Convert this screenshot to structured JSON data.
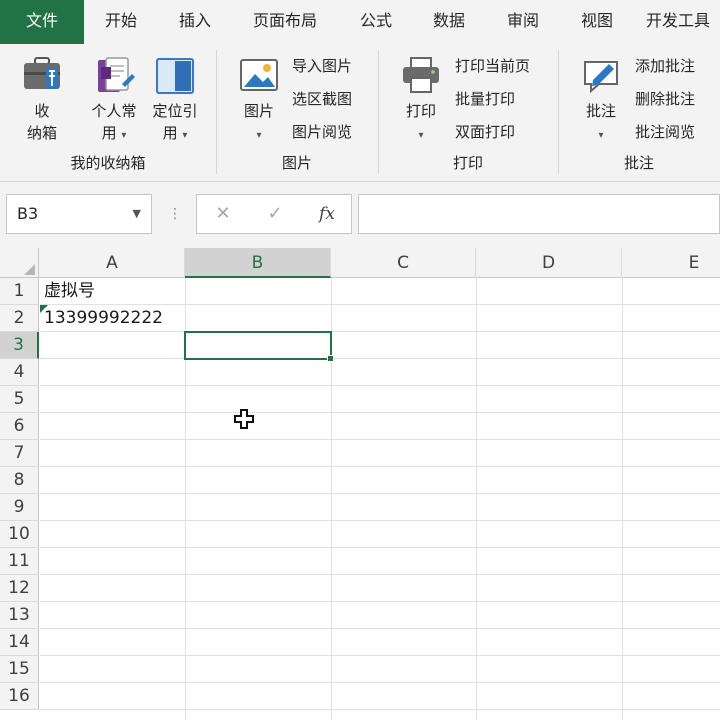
{
  "ribbon": {
    "tabs": [
      "文件",
      "开始",
      "插入",
      "页面布局",
      "公式",
      "数据",
      "审阅",
      "视图",
      "开发工具"
    ],
    "groups": {
      "storage": {
        "label": "我的收纳箱",
        "collect_line1": "收",
        "collect_line2": "纳箱",
        "personal_line1": "个人常",
        "personal_line2": "用",
        "locate_line1": "定位引",
        "locate_line2": "用"
      },
      "pictures": {
        "label": "图片",
        "picture_btn": "图片",
        "import": "导入图片",
        "capture": "选区截图",
        "browse": "图片阅览"
      },
      "print": {
        "label": "打印",
        "print_btn": "打印",
        "current": "打印当前页",
        "batch": "批量打印",
        "duplex": "双面打印"
      },
      "comments": {
        "label": "批注",
        "comment_btn": "批注",
        "add": "添加批注",
        "delete": "删除批注",
        "browse": "批注阅览"
      }
    }
  },
  "formula_bar": {
    "name_box": "B3",
    "dots": "⋮",
    "cancel": "✕",
    "confirm": "✓",
    "fx": "fx",
    "content": ""
  },
  "sheet": {
    "columns": [
      "A",
      "B",
      "C",
      "D",
      "E"
    ],
    "rows": [
      "1",
      "2",
      "3",
      "4",
      "5",
      "6",
      "7",
      "8",
      "9",
      "10",
      "11",
      "12",
      "13",
      "14",
      "15",
      "16"
    ],
    "active_cell": "B3",
    "cells": {
      "A1": "虚拟号",
      "A2": "13399992222"
    }
  },
  "colors": {
    "accent": "#217346",
    "ribbon_bg": "#f3f3f3",
    "grid_line": "#e1e1e1"
  }
}
